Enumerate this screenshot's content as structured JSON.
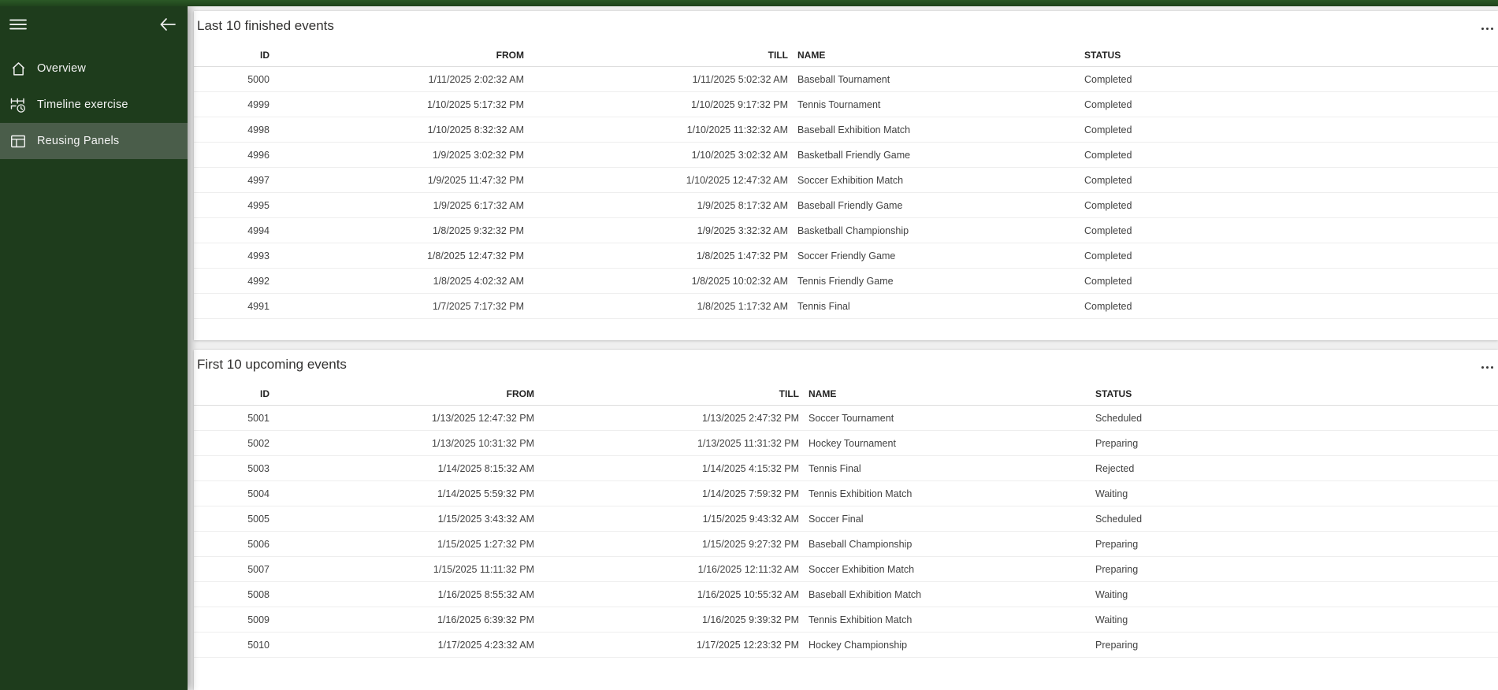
{
  "sidebar": {
    "menu_icon": "hamburger-icon",
    "collapse_icon": "arrow-left-icon",
    "items": [
      {
        "label": "Overview",
        "icon": "home-icon",
        "selected": false
      },
      {
        "label": "Timeline exercise",
        "icon": "timeline-clock-icon",
        "selected": false
      },
      {
        "label": "Reusing Panels",
        "icon": "window-panels-icon",
        "selected": true
      }
    ]
  },
  "panels": [
    {
      "title": "Last 10 finished events",
      "more_icon": "more-ellipsis-icon",
      "columns": [
        "ID",
        "FROM",
        "TILL",
        "NAME",
        "STATUS"
      ],
      "rows": [
        [
          "5000",
          "1/11/2025 2:02:32 AM",
          "1/11/2025 5:02:32 AM",
          "Baseball Tournament",
          "Completed"
        ],
        [
          "4999",
          "1/10/2025 5:17:32 PM",
          "1/10/2025 9:17:32 PM",
          "Tennis Tournament",
          "Completed"
        ],
        [
          "4998",
          "1/10/2025 8:32:32 AM",
          "1/10/2025 11:32:32 AM",
          "Baseball Exhibition Match",
          "Completed"
        ],
        [
          "4996",
          "1/9/2025 3:02:32 PM",
          "1/10/2025 3:02:32 AM",
          "Basketball Friendly Game",
          "Completed"
        ],
        [
          "4997",
          "1/9/2025 11:47:32 PM",
          "1/10/2025 12:47:32 AM",
          "Soccer Exhibition Match",
          "Completed"
        ],
        [
          "4995",
          "1/9/2025 6:17:32 AM",
          "1/9/2025 8:17:32 AM",
          "Baseball Friendly Game",
          "Completed"
        ],
        [
          "4994",
          "1/8/2025 9:32:32 PM",
          "1/9/2025 3:32:32 AM",
          "Basketball Championship",
          "Completed"
        ],
        [
          "4993",
          "1/8/2025 12:47:32 PM",
          "1/8/2025 1:47:32 PM",
          "Soccer Friendly Game",
          "Completed"
        ],
        [
          "4992",
          "1/8/2025 4:02:32 AM",
          "1/8/2025 10:02:32 AM",
          "Tennis Friendly Game",
          "Completed"
        ],
        [
          "4991",
          "1/7/2025 7:17:32 PM",
          "1/8/2025 1:17:32 AM",
          "Tennis Final",
          "Completed"
        ]
      ]
    },
    {
      "title": "First 10 upcoming events",
      "more_icon": "more-ellipsis-icon",
      "columns": [
        "ID",
        "FROM",
        "TILL",
        "NAME",
        "STATUS"
      ],
      "rows": [
        [
          "5001",
          "1/13/2025 12:47:32 PM",
          "1/13/2025 2:47:32 PM",
          "Soccer Tournament",
          "Scheduled"
        ],
        [
          "5002",
          "1/13/2025 10:31:32 PM",
          "1/13/2025 11:31:32 PM",
          "Hockey Tournament",
          "Preparing"
        ],
        [
          "5003",
          "1/14/2025 8:15:32 AM",
          "1/14/2025 4:15:32 PM",
          "Tennis Final",
          "Rejected"
        ],
        [
          "5004",
          "1/14/2025 5:59:32 PM",
          "1/14/2025 7:59:32 PM",
          "Tennis Exhibition Match",
          "Waiting"
        ],
        [
          "5005",
          "1/15/2025 3:43:32 AM",
          "1/15/2025 9:43:32 AM",
          "Soccer Final",
          "Scheduled"
        ],
        [
          "5006",
          "1/15/2025 1:27:32 PM",
          "1/15/2025 9:27:32 PM",
          "Baseball Championship",
          "Preparing"
        ],
        [
          "5007",
          "1/15/2025 11:11:32 PM",
          "1/16/2025 12:11:32 AM",
          "Soccer Exhibition Match",
          "Preparing"
        ],
        [
          "5008",
          "1/16/2025 8:55:32 AM",
          "1/16/2025 10:55:32 AM",
          "Baseball Exhibition Match",
          "Waiting"
        ],
        [
          "5009",
          "1/16/2025 6:39:32 PM",
          "1/16/2025 9:39:32 PM",
          "Tennis Exhibition Match",
          "Waiting"
        ],
        [
          "5010",
          "1/17/2025 4:23:32 AM",
          "1/17/2025 12:23:32 PM",
          "Hockey Championship",
          "Preparing"
        ]
      ]
    }
  ],
  "colors": {
    "topbar_green": "#2b5826",
    "sidebar_green": "#1e3c1c",
    "selected_item_green": "#4a5d4a",
    "page_background": "#efefef",
    "card_background": "#ffffff",
    "title_text": "#323130",
    "header_text": "#242424",
    "cell_text": "#424242"
  }
}
